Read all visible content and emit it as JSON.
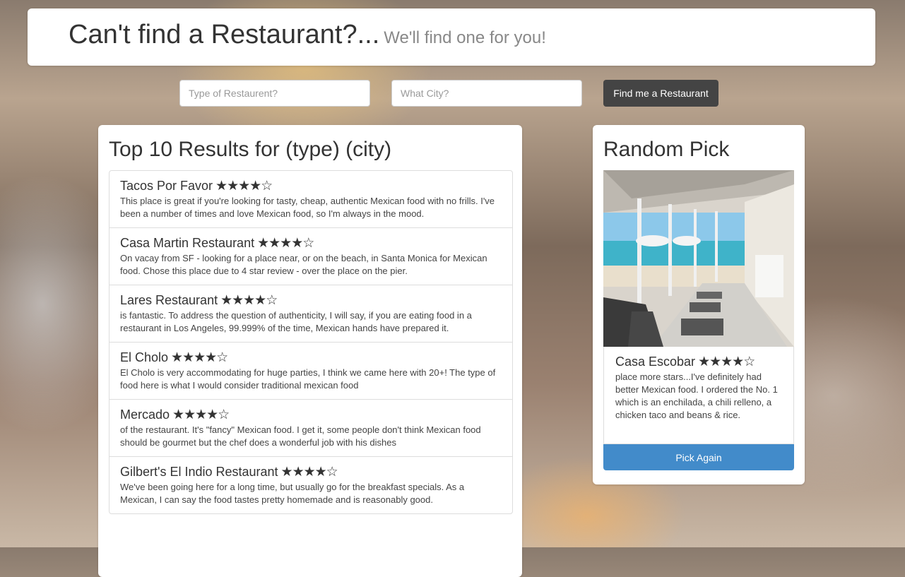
{
  "header": {
    "title": "Can't find a Restaurant?...",
    "subtitle": "We'll find one for you!"
  },
  "search": {
    "type_placeholder": "Type of Restaurent?",
    "city_placeholder": "What City?",
    "submit_label": "Find me a Restaurant"
  },
  "results": {
    "heading": "Top 10 Results for (type) (city)",
    "items": [
      {
        "name": "Tacos Por Favor",
        "rating": 4,
        "stars": "★★★★☆",
        "snippet": "This place is great if you're looking for tasty, cheap, authentic Mexican food with no frills. I've been a number of times and love Mexican food, so I'm always in the mood."
      },
      {
        "name": "Casa Martin Restaurant",
        "rating": 4,
        "stars": "★★★★☆",
        "snippet": "On vacay from SF - looking for a place near, or on the beach, in Santa Monica for Mexican food. Chose this place due to 4 star review - over the place on the pier."
      },
      {
        "name": "Lares Restaurant",
        "rating": 4,
        "stars": "★★★★☆",
        "snippet": "is fantastic. To address the question of authenticity, I will say, if you are eating food in a restaurant in Los Angeles, 99.999% of the time, Mexican hands have prepared it."
      },
      {
        "name": "El Cholo",
        "rating": 4,
        "stars": "★★★★☆",
        "snippet": "El Cholo is very accommodating for huge parties, I think we came here with 20+! The type of food here is what I would consider traditional mexican food"
      },
      {
        "name": "Mercado",
        "rating": 4,
        "stars": "★★★★☆",
        "snippet": "of the restaurant. It's \"fancy\" Mexican food. I get it, some people don't think Mexican food should be gourmet but the chef does a wonderful job with his dishes"
      },
      {
        "name": "Gilbert's El Indio Restaurant",
        "rating": 4,
        "stars": "★★★★☆",
        "snippet": "We've been going here for a long time, but usually go for the breakfast specials. As a Mexican, I can say the food tastes pretty homemade and is reasonably good."
      }
    ]
  },
  "random_pick": {
    "heading": "Random Pick",
    "name": "Casa Escobar",
    "rating": 4,
    "stars": "★★★★☆",
    "snippet": "place more stars...I've definitely had better Mexican food. I ordered the No. 1 which is an enchilada, a chili relleno, a chicken taco and beans & rice.",
    "button_label": "Pick Again"
  },
  "colors": {
    "primary_button": "#428bca",
    "dark_button": "#444444"
  }
}
